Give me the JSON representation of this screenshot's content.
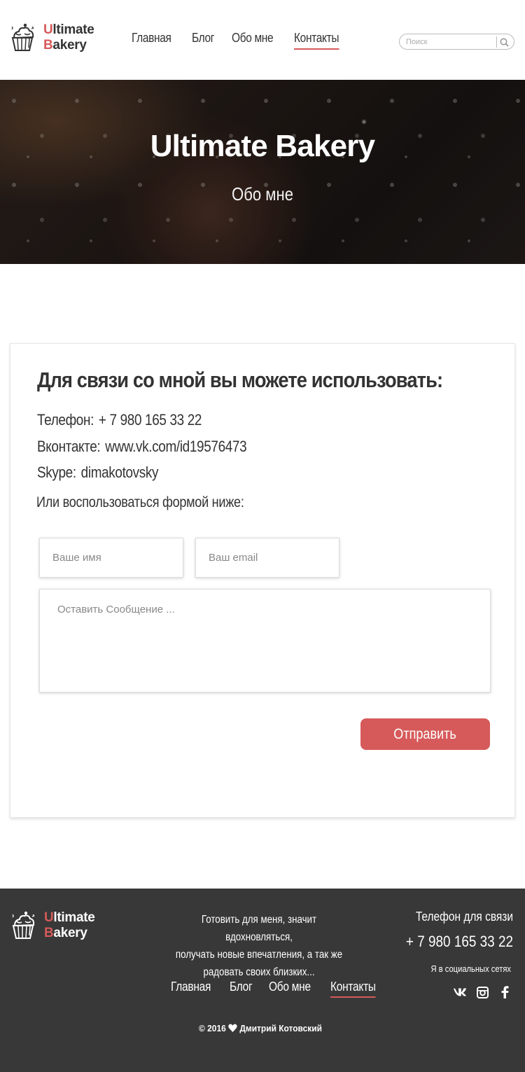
{
  "brand": {
    "first_letter_1": "U",
    "rest_1": "ltimate",
    "first_letter_2": "B",
    "rest_2": "akery",
    "accent_color": "#d65a5a"
  },
  "nav": {
    "items": [
      {
        "label": "Главная"
      },
      {
        "label": "Блог"
      },
      {
        "label": "Обо мне"
      },
      {
        "label": "Контакты",
        "active": true
      }
    ]
  },
  "search": {
    "placeholder": "Поиск",
    "icon": "search-icon"
  },
  "hero": {
    "title": "Ultimate Bakery",
    "subtitle": "Обо мне"
  },
  "contact": {
    "heading": "Для связи со мной вы можете использовать:",
    "phone_label": "Телефон:",
    "phone_value": "+ 7 980 165 33 22",
    "vk_label": "Вконтакте:",
    "vk_value": "www.vk.com/id19576473",
    "skype_label": "Skype:",
    "skype_value": "dimakotovsky",
    "form_intro": "Или воспользоваться формой ниже:",
    "name_placeholder": "Ваше имя",
    "email_placeholder": "Ваш email",
    "message_placeholder": "Оставить Сообщение ...",
    "submit_label": "Отправить"
  },
  "footer": {
    "about_line_1": "Готовить для меня, значит вдохновляться,",
    "about_line_2": "получать новые впечатления, а так же",
    "about_line_3": "радовать своих близких...",
    "phone_label": "Телефон для связи",
    "phone": "+ 7 980 165 33 22",
    "social_label": "Я в социальных сетях",
    "social_icons": [
      "vk-icon",
      "instagram-icon",
      "facebook-icon"
    ],
    "copyright_prefix": "© 2016",
    "copyright_author": "Дмитрий Котовский"
  }
}
